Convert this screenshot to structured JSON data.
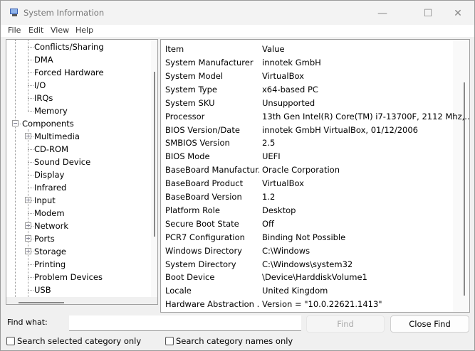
{
  "window": {
    "title": "System Information",
    "app_icon": "system-information-icon",
    "controls": [
      "minimize-icon",
      "maximize-icon",
      "close-icon"
    ]
  },
  "menu": [
    "File",
    "Edit",
    "View",
    "Help"
  ],
  "tree": [
    {
      "label": "Conflicts/Sharing",
      "level": 2,
      "expander": null
    },
    {
      "label": "DMA",
      "level": 2,
      "expander": null
    },
    {
      "label": "Forced Hardware",
      "level": 2,
      "expander": null
    },
    {
      "label": "I/O",
      "level": 2,
      "expander": null
    },
    {
      "label": "IRQs",
      "level": 2,
      "expander": null
    },
    {
      "label": "Memory",
      "level": 2,
      "expander": null
    },
    {
      "label": "Components",
      "level": 1,
      "expander": "minus"
    },
    {
      "label": "Multimedia",
      "level": 2,
      "expander": "plus"
    },
    {
      "label": "CD-ROM",
      "level": 2,
      "expander": null
    },
    {
      "label": "Sound Device",
      "level": 2,
      "expander": null
    },
    {
      "label": "Display",
      "level": 2,
      "expander": null
    },
    {
      "label": "Infrared",
      "level": 2,
      "expander": null
    },
    {
      "label": "Input",
      "level": 2,
      "expander": "plus"
    },
    {
      "label": "Modem",
      "level": 2,
      "expander": null
    },
    {
      "label": "Network",
      "level": 2,
      "expander": "plus"
    },
    {
      "label": "Ports",
      "level": 2,
      "expander": "plus"
    },
    {
      "label": "Storage",
      "level": 2,
      "expander": "plus"
    },
    {
      "label": "Printing",
      "level": 2,
      "expander": null
    },
    {
      "label": "Problem Devices",
      "level": 2,
      "expander": null
    },
    {
      "label": "USB",
      "level": 2,
      "expander": null
    }
  ],
  "list": {
    "columns": [
      "Item",
      "Value"
    ],
    "rows": [
      [
        "System Manufacturer",
        "innotek GmbH"
      ],
      [
        "System Model",
        "VirtualBox"
      ],
      [
        "System Type",
        "x64-based PC"
      ],
      [
        "System SKU",
        "Unsupported"
      ],
      [
        "Processor",
        "13th Gen Intel(R) Core(TM) i7-13700F, 2112 Mhz,..."
      ],
      [
        "BIOS Version/Date",
        "innotek GmbH VirtualBox, 01/12/2006"
      ],
      [
        "SMBIOS Version",
        "2.5"
      ],
      [
        "BIOS Mode",
        "UEFI"
      ],
      [
        "BaseBoard Manufactur...",
        "Oracle Corporation"
      ],
      [
        "BaseBoard Product",
        "VirtualBox"
      ],
      [
        "BaseBoard Version",
        "1.2"
      ],
      [
        "Platform Role",
        "Desktop"
      ],
      [
        "Secure Boot State",
        "Off"
      ],
      [
        "PCR7 Configuration",
        "Binding Not Possible"
      ],
      [
        "Windows Directory",
        "C:\\Windows"
      ],
      [
        "System Directory",
        "C:\\Windows\\system32"
      ],
      [
        "Boot Device",
        "\\Device\\HarddiskVolume1"
      ],
      [
        "Locale",
        "United Kingdom"
      ],
      [
        "Hardware Abstraction ...",
        "Version = \"10.0.22621.1413\""
      ]
    ]
  },
  "find": {
    "label": "Find what:",
    "value": "",
    "find_button": "Find",
    "close_button": "Close Find",
    "search_selected": "Search selected category only",
    "search_names": "Search category names only"
  }
}
